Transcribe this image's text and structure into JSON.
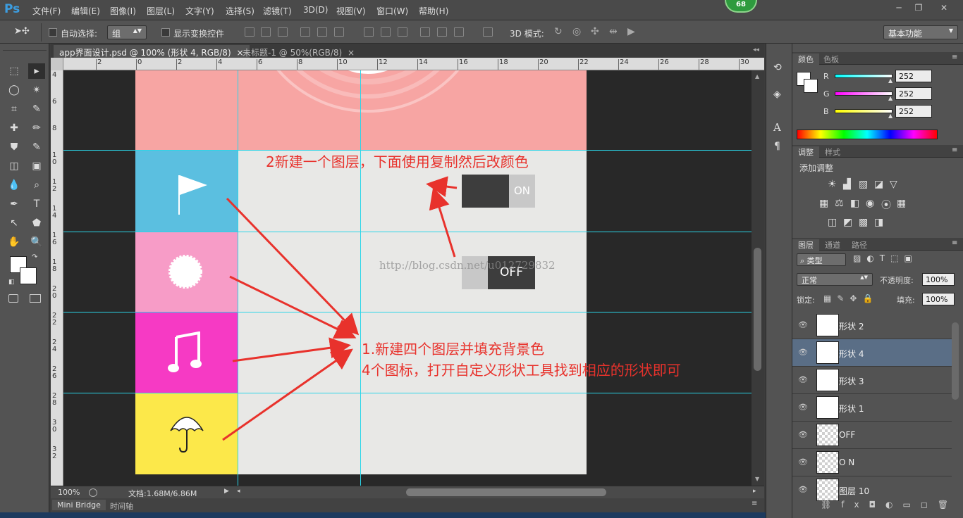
{
  "app": {
    "logo": "Ps",
    "badge": "68"
  },
  "menu": [
    "文件(F)",
    "编辑(E)",
    "图像(I)",
    "图层(L)",
    "文字(Y)",
    "选择(S)",
    "滤镜(T)",
    "3D(D)",
    "视图(V)",
    "窗口(W)",
    "帮助(H)"
  ],
  "window_controls": [
    "─",
    "❐",
    "✕"
  ],
  "options": {
    "auto_select_label": "自动选择:",
    "auto_select_value": "组",
    "show_transform_label": "显示变换控件",
    "mode_3d_label": "3D 模式:",
    "workspace": "基本功能"
  },
  "tabs": [
    {
      "label": "app界面设计.psd @ 100% (形状 4, RGB/8)",
      "close": "×",
      "active": true
    },
    {
      "label": "未标题-1 @ 50%(RGB/8)",
      "close": "×",
      "active": false
    }
  ],
  "ruler_h": [
    "2",
    "0",
    "2",
    "4",
    "6",
    "8",
    "10",
    "12",
    "14",
    "16",
    "18",
    "20",
    "22",
    "24",
    "26",
    "28",
    "30"
  ],
  "ruler_v": [
    "4",
    "6",
    "8",
    "1 0",
    "1 2",
    "1 4",
    "1 6",
    "1 8",
    "2 0",
    "2 2",
    "2 4",
    "2 6",
    "2 8",
    "3 0",
    "3 2"
  ],
  "canvas": {
    "toggle_on": "ON",
    "toggle_off": "OFF",
    "watermark": "http://blog.csdn.net/u012729832",
    "annotation_top": "2新建一个图层，下面使用复制然后改颜色",
    "annotation_1": "1.新建四个图层并填充背景色",
    "annotation_2": "4个图标，打开自定义形状工具找到相应的形状即可",
    "colors": {
      "pink_top": "#f7a5a3",
      "blue": "#5bbfe0",
      "light_pink": "#f79cc7",
      "magenta": "#f63ac4",
      "yellow": "#fce84a",
      "dark_toggle": "#3d3d3d",
      "light_toggle": "#c8c8c8",
      "annotation": "#e8322c"
    }
  },
  "status": {
    "zoom": "100%",
    "doc_info": "文档:1.68M/6.86M"
  },
  "bottom_tabs": [
    "Mini Bridge",
    "时间轴"
  ],
  "color_panel": {
    "tabs": [
      "颜色",
      "色板"
    ],
    "channels": [
      {
        "label": "R",
        "value": "252"
      },
      {
        "label": "G",
        "value": "252"
      },
      {
        "label": "B",
        "value": "252"
      }
    ]
  },
  "adjust_panel": {
    "tabs": [
      "调整",
      "样式"
    ],
    "title": "添加调整"
  },
  "layers_panel": {
    "tabs": [
      "图层",
      "通道",
      "路径"
    ],
    "filter_label": "类型",
    "blend_mode": "正常",
    "opacity_label": "不透明度:",
    "opacity_value": "100%",
    "lock_label": "锁定:",
    "fill_label": "填充:",
    "fill_value": "100%",
    "layers": [
      {
        "name": "形状 2",
        "selected": false,
        "check": false
      },
      {
        "name": "形状 4",
        "selected": true,
        "check": false
      },
      {
        "name": "形状 3",
        "selected": false,
        "check": false
      },
      {
        "name": "形状 1",
        "selected": false,
        "check": false
      },
      {
        "name": "OFF",
        "selected": false,
        "check": true
      },
      {
        "name": "O N",
        "selected": false,
        "check": true
      },
      {
        "name": "图层 10",
        "selected": false,
        "check": true
      }
    ]
  }
}
